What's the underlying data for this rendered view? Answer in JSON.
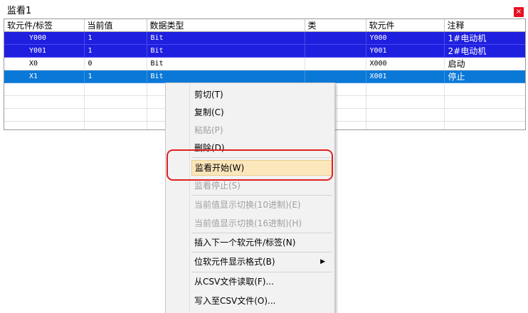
{
  "window": {
    "title": "监看1",
    "close_glyph": "×"
  },
  "grid": {
    "columns": [
      "软元件/标签",
      "当前值",
      "数据类型",
      "类",
      "软元件",
      "注释"
    ],
    "rows": [
      {
        "device": "Y000",
        "value": "1",
        "type": "Bit",
        "class": "",
        "dev2": "Y000",
        "comment": "1#电动机"
      },
      {
        "device": "Y001",
        "value": "1",
        "type": "Bit",
        "class": "",
        "dev2": "Y001",
        "comment": "2#电动机"
      },
      {
        "device": "X0",
        "value": "0",
        "type": "Bit",
        "class": "",
        "dev2": "X000",
        "comment": "启动"
      },
      {
        "device": "X1",
        "value": "1",
        "type": "Bit",
        "class": "",
        "dev2": "X001",
        "comment": "停止"
      }
    ]
  },
  "context_menu": {
    "cut": "剪切(T)",
    "copy": "复制(C)",
    "paste": "粘贴(P)",
    "delete": "删除(D)",
    "start_monitor": "监看开始(W)",
    "stop_monitor": "监看停止(S)",
    "toggle_dec": "当前值显示切换(10进制)(E)",
    "toggle_hex": "当前值显示切换(16进制)(H)",
    "insert_next": "插入下一个软元件/标签(N)",
    "bit_format": "位软元件显示格式(B)",
    "bit_format_arrow": "▶",
    "read_csv": "从CSV文件读取(F)...",
    "write_csv": "写入至CSV文件(O)..."
  },
  "colors": {
    "row_selected_dark": "#1f1fe0",
    "row_selected": "#0a78d7",
    "menu_highlight": "#fce6bb",
    "callout": "#e02020"
  }
}
